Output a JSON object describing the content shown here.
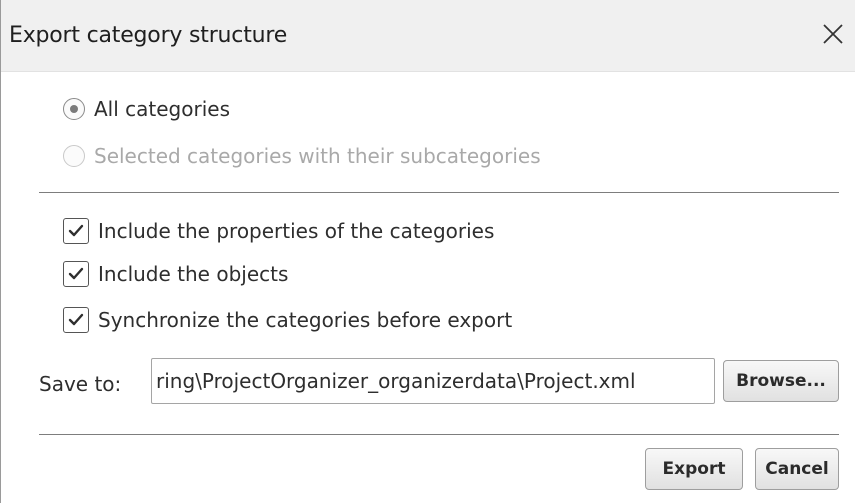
{
  "dialog": {
    "title": "Export category structure",
    "close_icon": "close-icon"
  },
  "scope": {
    "options": [
      {
        "label": "All categories",
        "selected": true,
        "enabled": true
      },
      {
        "label": "Selected categories with their subcategories",
        "selected": false,
        "enabled": false
      }
    ]
  },
  "options": {
    "checkboxes": [
      {
        "label": "Include the properties of the categories",
        "checked": true
      },
      {
        "label": "Include the objects",
        "checked": true
      },
      {
        "label": "Synchronize the categories before export",
        "checked": true
      }
    ]
  },
  "save": {
    "label": "Save to:",
    "path": "ring\\ProjectOrganizer_organizerdata\\Project.xml",
    "browse_label": "Browse..."
  },
  "footer": {
    "export_label": "Export",
    "cancel_label": "Cancel"
  }
}
